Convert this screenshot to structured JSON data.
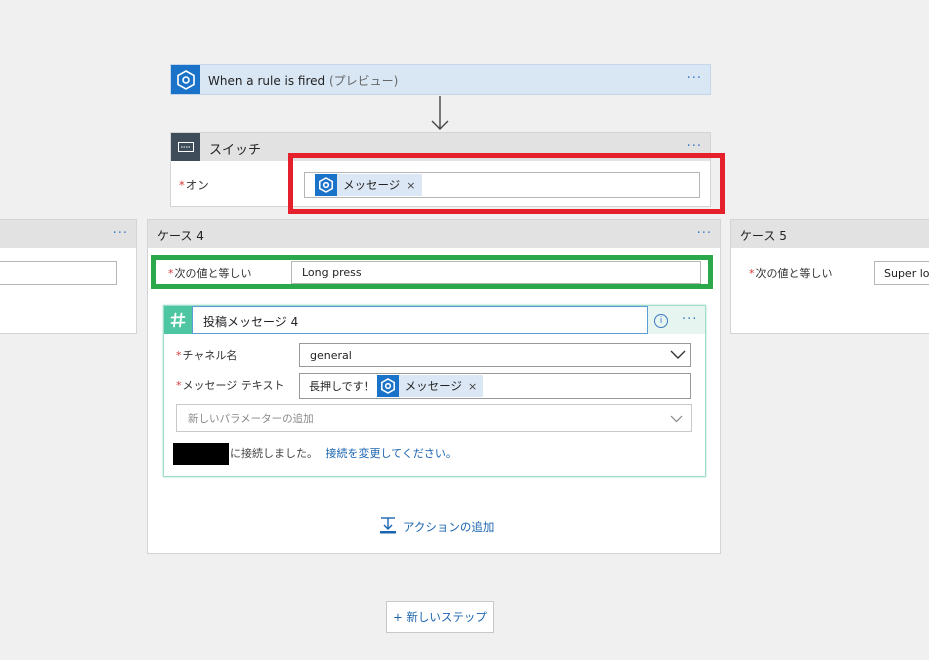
{
  "trigger": {
    "title": "When a rule is fired",
    "suffix": "(プレビュー)",
    "menu": "···"
  },
  "switch_card": {
    "title": "スイッチ",
    "menu": "···",
    "on_label": "オン",
    "required_mark": "*",
    "token_label": "メッセージ",
    "token_remove": "×"
  },
  "case_left": {
    "menu": "···"
  },
  "case4": {
    "title": "ケース 4",
    "menu": "···",
    "equals_label": "次の値と等しい",
    "equals_value": "Long press"
  },
  "case5": {
    "title": "ケース 5",
    "equals_label": "次の値と等しい",
    "equals_value": "Super lon"
  },
  "slack_action": {
    "title": "投稿メッセージ 4",
    "info_glyph": "i",
    "menu": "···",
    "channel_label": "チャネル名",
    "channel_value": "general",
    "text_label": "メッセージ テキスト",
    "text_prefix": "長押しです！",
    "token_label": "メッセージ",
    "token_remove": "×",
    "add_param_placeholder": "新しいパラメーターの追加",
    "connected_text": "に接続しました。",
    "change_connection_link": "接続を変更してください。"
  },
  "add_action_label": "アクションの追加",
  "new_step_label": "+ 新しいステップ",
  "colors": {
    "accent_blue": "#1a73c9",
    "slack_green": "#4fc6a2",
    "highlight_red": "#e5202c",
    "highlight_green": "#2aa84a"
  },
  "icons": [
    "flow-trigger-icon",
    "arrow-down-icon",
    "switch-icon",
    "slack-icon",
    "info-icon",
    "chevron-down-icon",
    "add-action-icon"
  ]
}
